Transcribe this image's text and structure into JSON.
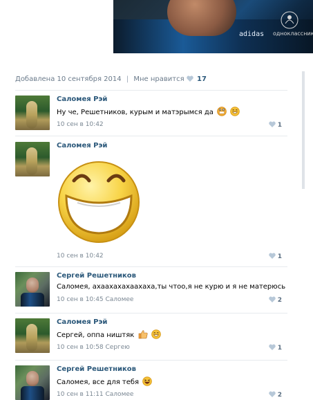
{
  "photo": {
    "brand_text": "adidas",
    "watermark": "одноклассники"
  },
  "post_meta": {
    "added": "Добавлена 10 сентября 2014",
    "likes_label": "Мне нравится",
    "likes_count": "17"
  },
  "comments": [
    {
      "name": "Саломея Рэй",
      "text": "Ну че, Решетников, курым и матэрымся да",
      "time": "10 сен в 10:42",
      "likes": "1"
    },
    {
      "name": "Саломея Рэй",
      "text": "",
      "time": "10 сен в 10:42",
      "likes": "1"
    },
    {
      "name": "Сергей Решетников",
      "text": "Саломея, ахаахахахаахаха,ты чтоо,я не курю и я не матерюсь",
      "time": "10 сен в 10:45 Саломее",
      "likes": "2"
    },
    {
      "name": "Саломея Рэй",
      "text": "Сергей, оппа ништяк",
      "time": "10 сен в 10:58 Сергею",
      "likes": "1"
    },
    {
      "name": "Сергей Решетников",
      "text": "Саломея, все для тебя",
      "time": "10 сен в 11:11 Саломее",
      "likes": "2"
    }
  ],
  "icons": {
    "like": "heart-icon",
    "smile": "smile-emoji-icon",
    "grin": "grin-emoji-icon",
    "thumbs": "thumbs-up-emoji-icon",
    "laugh": "laughing-emoji-icon"
  },
  "colors": {
    "link": "#2b587a",
    "heart": "#b7c8d8",
    "meta": "#6b7b8b",
    "divider": "#e7eaed"
  }
}
